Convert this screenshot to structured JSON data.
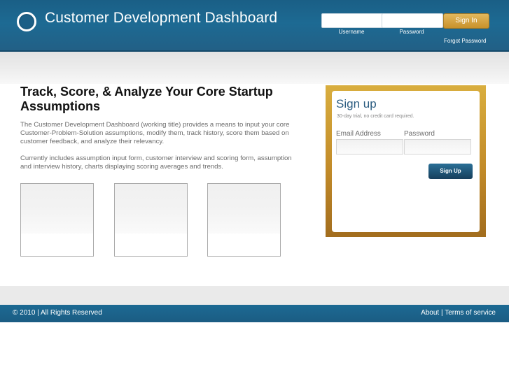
{
  "header": {
    "title": "Customer Development Dashboard",
    "username_label": "Username",
    "password_label": "Password",
    "username_value": "",
    "password_value": "",
    "signin_label": "Sign In",
    "forgot_label": "Forgot Password"
  },
  "main": {
    "headline": "Track, Score, & Analyze Your Core Startup Assumptions",
    "intro": "The Customer Development Dashboard (working title) provides a means to input your core Customer-Problem-Solution assumptions, modify them, track history, score them based on customer feedback, and analyze their relevancy.",
    "intro2": "Currently includes assumption input form, customer interview and scoring form, assumption and interview history, charts displaying scoring averages and trends."
  },
  "signup": {
    "title": "Sign up",
    "subtitle": "30-day trial, no credit card required.",
    "email_label": "Email Address",
    "password_label": "Password",
    "email_value": "",
    "password_value": "",
    "button_label": "Sign Up"
  },
  "footer": {
    "copyright": "© 2010 | All Rights Reserved",
    "about_label": "About",
    "separator": " | ",
    "terms_label": "Terms of service"
  },
  "colors": {
    "header_blue": "#1d6a93",
    "gold": "#c28b29",
    "signup_title": "#2b5c80"
  }
}
